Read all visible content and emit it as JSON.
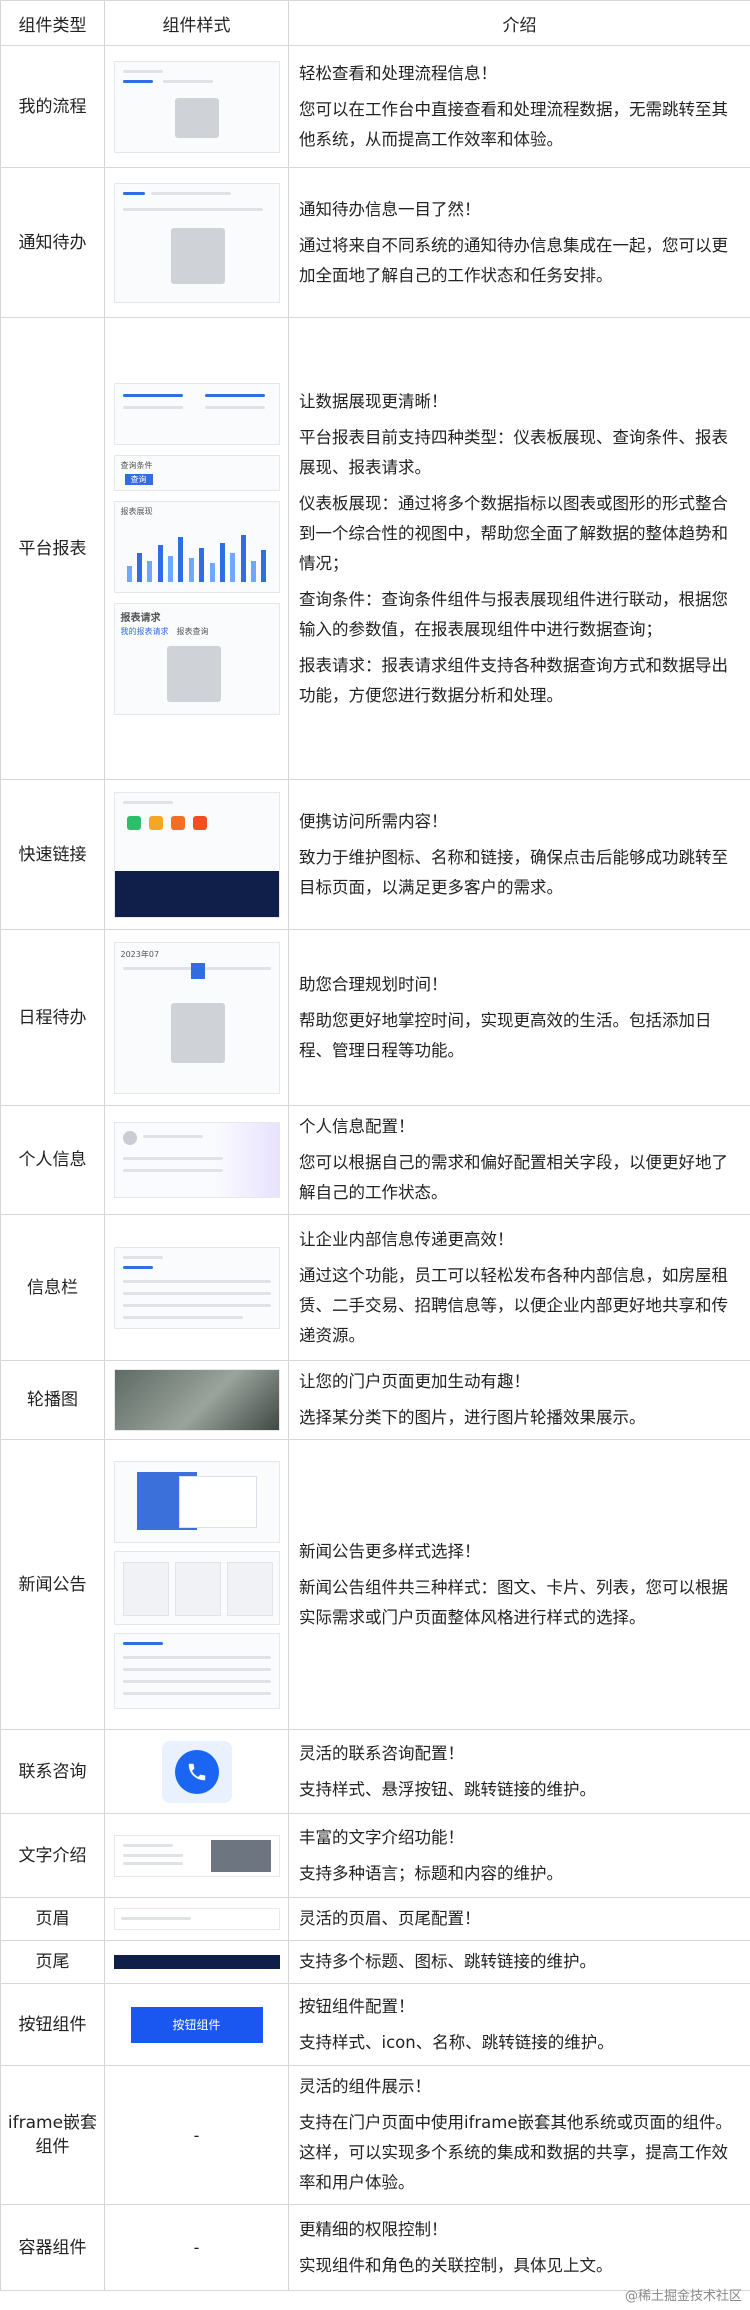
{
  "header": {
    "col1": "组件类型",
    "col2": "组件样式",
    "col3": "介绍"
  },
  "rows": [
    {
      "type": "我的流程",
      "lines": [
        "轻松查看和处理流程信息！",
        "您可以在工作台中直接查看和处理流程数据，无需跳转至其他系统，从而提高工作效率和体验。"
      ]
    },
    {
      "type": "通知待办",
      "lines": [
        "通知待办信息一目了然！",
        "通过将来自不同系统的通知待办信息集成在一起，您可以更加全面地了解自己的工作状态和任务安排。"
      ]
    },
    {
      "type": "平台报表",
      "lines": [
        "让数据展现更清晰！",
        "平台报表目前支持四种类型：仪表板展现、查询条件、报表展现、报表请求。",
        "仪表板展现：通过将多个数据指标以图表或图形的形式整合到一个综合性的视图中，帮助您全面了解数据的整体趋势和情况；",
        "查询条件：查询条件组件与报表展现组件进行联动，根据您输入的参数值，在报表展现组件中进行数据查询；",
        "报表请求：报表请求组件支持各种数据查询方式和数据导出功能，方便您进行数据分析和处理。"
      ]
    },
    {
      "type": "快速链接",
      "lines": [
        "便携访问所需内容！",
        "致力于维护图标、名称和链接，确保点击后能够成功跳转至目标页面，以满足更多客户的需求。"
      ]
    },
    {
      "type": "日程待办",
      "lines": [
        "助您合理规划时间！",
        "帮助您更好地掌控时间，实现更高效的生活。包括添加日程、管理日程等功能。"
      ]
    },
    {
      "type": "个人信息",
      "lines": [
        "个人信息配置！",
        "您可以根据自己的需求和偏好配置相关字段，以便更好地了解自己的工作状态。"
      ]
    },
    {
      "type": "信息栏",
      "lines": [
        "让企业内部信息传递更高效！",
        "通过这个功能，员工可以轻松发布各种内部信息，如房屋租赁、二手交易、招聘信息等，以便企业内部更好地共享和传递资源。"
      ]
    },
    {
      "type": "轮播图",
      "lines": [
        "让您的门户页面更加生动有趣！",
        "选择某分类下的图片，进行图片轮播效果展示。"
      ]
    },
    {
      "type": "新闻公告",
      "lines": [
        "新闻公告更多样式选择！",
        "新闻公告组件共三种样式：图文、卡片、列表，您可以根据实际需求或门户页面整体风格进行样式的选择。"
      ]
    },
    {
      "type": "联系咨询",
      "lines": [
        "灵活的联系咨询配置！",
        "支持样式、悬浮按钮、跳转链接的维护。"
      ]
    },
    {
      "type": "文字介绍",
      "lines": [
        "丰富的文字介绍功能！",
        "支持多种语言；标题和内容的维护。"
      ]
    },
    {
      "type": "页眉",
      "lines": [
        "灵活的页眉、页尾配置！"
      ]
    },
    {
      "type": "页尾",
      "lines": [
        "支持多个标题、图标、跳转链接的维护。"
      ]
    },
    {
      "type": "按钮组件",
      "button_label": "按钮组件",
      "lines": [
        "按钮组件配置！",
        "支持样式、icon、名称、跳转链接的维护。"
      ]
    },
    {
      "type": "iframe嵌套组件",
      "dash": "-",
      "lines": [
        "灵活的组件展示！",
        "支持在门户页面中使用iframe嵌套其他系统或页面的组件。这样，可以实现多个系统的集成和数据的共享，提高工作效率和用户体验。"
      ]
    },
    {
      "type": "容器组件",
      "dash": "-",
      "lines": [
        "更精细的权限控制！",
        "实现组件和角色的关联控制，具体见上文。"
      ]
    }
  ],
  "thumb_text": {
    "calendar_year": "2023年07",
    "report_title": "报表请求",
    "report_tab": "我的报表请求",
    "report_tab2": "报表查询",
    "query_title": "查询条件",
    "query_btn": "查询",
    "dashboard_title": "报表展现"
  },
  "watermark": "@稀土掘金技术社区",
  "colors": {
    "accent": "#1a56f0",
    "dark": "#0f1f4a"
  }
}
